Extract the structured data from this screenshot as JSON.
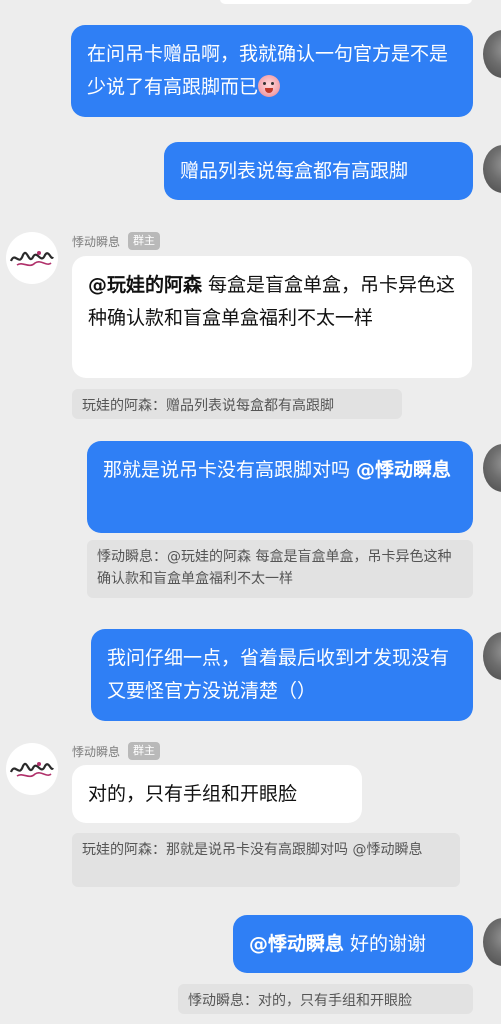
{
  "messages": [
    {
      "direction": "out",
      "text": "在问吊卡赠品啊，我就确认一句官方是不是少说了有高跟脚而已"
    },
    {
      "direction": "out",
      "text": "赠品列表说每盒都有高跟脚"
    },
    {
      "direction": "in",
      "sender": "悸动瞬息",
      "badge": "群主",
      "mention": "@玩娃的阿森",
      "text": " 每盒是盲盒单盒，吊卡异色这种确认款和盲盒单盒福利不太一样",
      "quote": "玩娃的阿森：赠品列表说每盒都有高跟脚"
    },
    {
      "direction": "out",
      "text": "那就是说吊卡没有高跟脚对吗 ",
      "mention": "@悸动瞬息",
      "quote": "悸动瞬息：@玩娃的阿森 每盒是盲盒单盒，吊卡异色这种确认款和盲盒单盒福利不太一样"
    },
    {
      "direction": "out",
      "text": "我问仔细一点，省着最后收到才发现没有又要怪官方没说清楚（）"
    },
    {
      "direction": "in",
      "sender": "悸动瞬息",
      "badge": "群主",
      "text": "对的，只有手组和开眼脸",
      "quote": "玩娃的阿森：那就是说吊卡没有高跟脚对吗 @悸动瞬息"
    },
    {
      "direction": "out",
      "mention": "@悸动瞬息",
      "text": " 好的谢谢",
      "quote": "悸动瞬息：对的，只有手组和开眼脸"
    }
  ],
  "icons": {
    "emoji": "crying-face-emoji",
    "group_avatar": "group-owner-avatar",
    "my_avatar": "user-avatar"
  },
  "colors": {
    "outgoing_bubble": "#2f7ff5",
    "incoming_bubble": "#ffffff",
    "background": "#ededed",
    "quote_background": "#e2e2e2",
    "badge": "#b9b9b9"
  }
}
